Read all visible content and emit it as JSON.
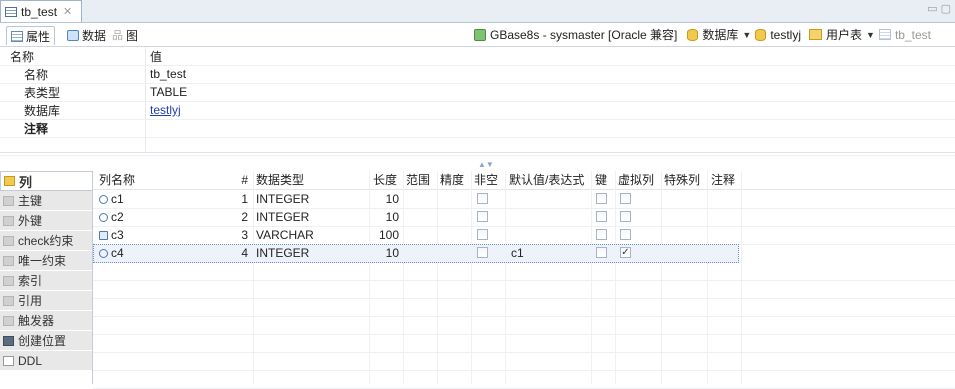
{
  "editor": {
    "tab_title": "tb_test",
    "tab_close": "✕",
    "window_controls": "▭ ▢"
  },
  "subtabs": {
    "properties": "属性",
    "data": "数据",
    "diagram": "图"
  },
  "connection": {
    "server": "GBase8s - sysmaster [Oracle 兼容]",
    "database_label": "数据库",
    "database_value": "testlyj",
    "user_tables": "用户表",
    "table_crumb": "tb_test"
  },
  "properties": {
    "header_name": "名称",
    "header_value": "值",
    "rows": [
      {
        "label": "名称",
        "value": "tb_test"
      },
      {
        "label": "表类型",
        "value": "TABLE"
      },
      {
        "label": "数据库",
        "value": "testlyj"
      },
      {
        "label": "注释",
        "value": ""
      }
    ]
  },
  "sidenav": [
    {
      "label": "列",
      "icon": "column-icon"
    },
    {
      "label": "主键",
      "icon": "primary-key-icon"
    },
    {
      "label": "外键",
      "icon": "foreign-key-icon"
    },
    {
      "label": "check约束",
      "icon": "check-constraint-icon"
    },
    {
      "label": "唯一约束",
      "icon": "unique-constraint-icon"
    },
    {
      "label": "索引",
      "icon": "index-icon"
    },
    {
      "label": "引用",
      "icon": "reference-icon"
    },
    {
      "label": "触发器",
      "icon": "trigger-icon"
    },
    {
      "label": "创建位置",
      "icon": "location-icon"
    },
    {
      "label": "DDL",
      "icon": "ddl-icon"
    }
  ],
  "columns_grid": {
    "headers": [
      "列名称",
      "#",
      "数据类型",
      "长度",
      "范围",
      "精度",
      "非空",
      "默认值/表达式",
      "键",
      "虚拟列",
      "特殊列",
      "注释"
    ],
    "rows": [
      {
        "name": "c1",
        "num": "1",
        "type": "INTEGER",
        "length": "10",
        "scale": "",
        "precision": "",
        "not_null": false,
        "default": "",
        "key": false,
        "virtual": false,
        "special": "",
        "comment": ""
      },
      {
        "name": "c2",
        "num": "2",
        "type": "INTEGER",
        "length": "10",
        "scale": "",
        "precision": "",
        "not_null": false,
        "default": "",
        "key": false,
        "virtual": false,
        "special": "",
        "comment": ""
      },
      {
        "name": "c3",
        "num": "3",
        "type": "VARCHAR",
        "length": "100",
        "scale": "",
        "precision": "",
        "not_null": false,
        "default": "",
        "key": false,
        "virtual": false,
        "special": "",
        "comment": ""
      },
      {
        "name": "c4",
        "num": "4",
        "type": "INTEGER",
        "length": "10",
        "scale": "",
        "precision": "",
        "not_null": false,
        "default": "c1",
        "key": false,
        "virtual": true,
        "special": "",
        "comment": ""
      }
    ],
    "selected_row": 3
  }
}
